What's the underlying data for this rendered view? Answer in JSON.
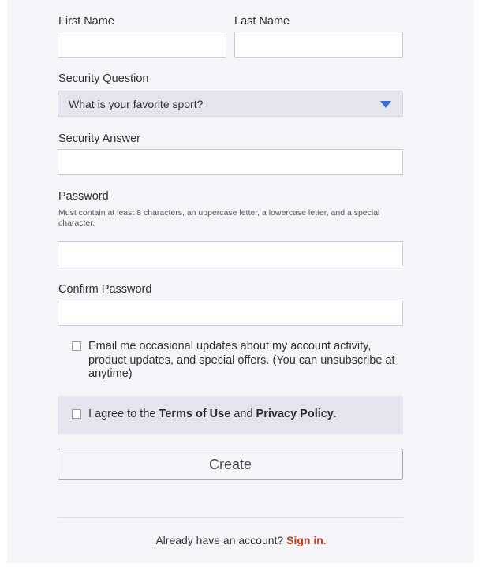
{
  "form": {
    "first_name": {
      "label": "First Name",
      "value": ""
    },
    "last_name": {
      "label": "Last Name",
      "value": ""
    },
    "security_question": {
      "label": "Security Question",
      "selected": "What is your favorite sport?"
    },
    "security_answer": {
      "label": "Security Answer",
      "value": ""
    },
    "password": {
      "label": "Password",
      "hint": "Must contain at least 8 characters, an uppercase letter, a lowercase letter, and a special character.",
      "value": ""
    },
    "confirm_password": {
      "label": "Confirm Password",
      "value": ""
    },
    "email_updates": {
      "text": "Email me occasional updates about my account activity, product updates, and special offers. (You can unsubscribe at anytime)",
      "checked": false
    },
    "agree": {
      "prefix": "I agree to the ",
      "terms": "Terms of Use",
      "and": " and ",
      "privacy": "Privacy Policy",
      "suffix": ".",
      "checked": false
    },
    "create_label": "Create"
  },
  "footer": {
    "prompt": "Already have an account? ",
    "signin_label": "Sign in."
  },
  "colors": {
    "panel_bg": "#f4f4f9",
    "select_bg": "#e4e4ee",
    "caret": "#3b6fd4",
    "signin_link": "#c4401c"
  }
}
